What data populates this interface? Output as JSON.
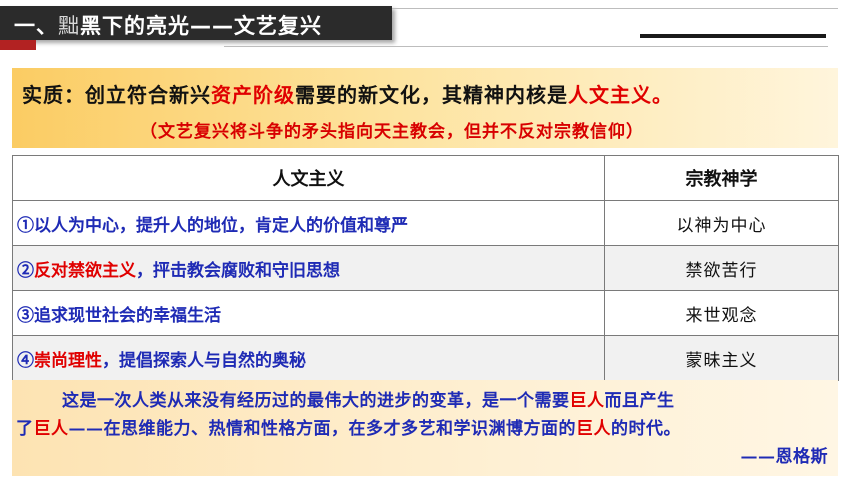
{
  "header": {
    "title_prefix": "一、",
    "title_dim": "黜",
    "title_main": "黑下的亮光——文艺复兴"
  },
  "essence": {
    "line1_a": "实质：创立符合新兴",
    "line1_red1": "资产阶级",
    "line1_b": "需要的新文化，其精神内核是",
    "line1_red2": "人文主义。",
    "line2": "（文艺复兴将斗争的矛头指向天主教会，但并不反对宗教信仰）"
  },
  "table": {
    "headers": [
      "人文主义",
      "宗教神学"
    ],
    "rows": [
      {
        "num": "①",
        "red": "",
        "text": "以人为中心，提升人的地位，肯定人的价值和尊严",
        "right": "以神为中心"
      },
      {
        "num": "②",
        "red": "反对禁欲主义",
        "text": "，抨击教会腐败和守旧思想",
        "right": "禁欲苦行"
      },
      {
        "num": "③",
        "red": "",
        "text": "追求现世社会的幸福生活",
        "right": "来世观念"
      },
      {
        "num": "④",
        "red": "崇尚理性",
        "text": "，提倡探索人与自然的奥秘",
        "right": "蒙昧主义"
      }
    ]
  },
  "quote": {
    "line1_a": "这是一次人类从来没有经历过的最伟大的进步的变革，是一个需要",
    "line1_red": "巨人",
    "line1_b": "而且产生",
    "line2_a": "了",
    "line2_red1": "巨人",
    "line2_b": "——在思维能力、热情和性格方面，在多才多艺和学识渊博方面的",
    "line2_red2": "巨人",
    "line2_c": "的时代。",
    "author": "——恩格斯"
  }
}
